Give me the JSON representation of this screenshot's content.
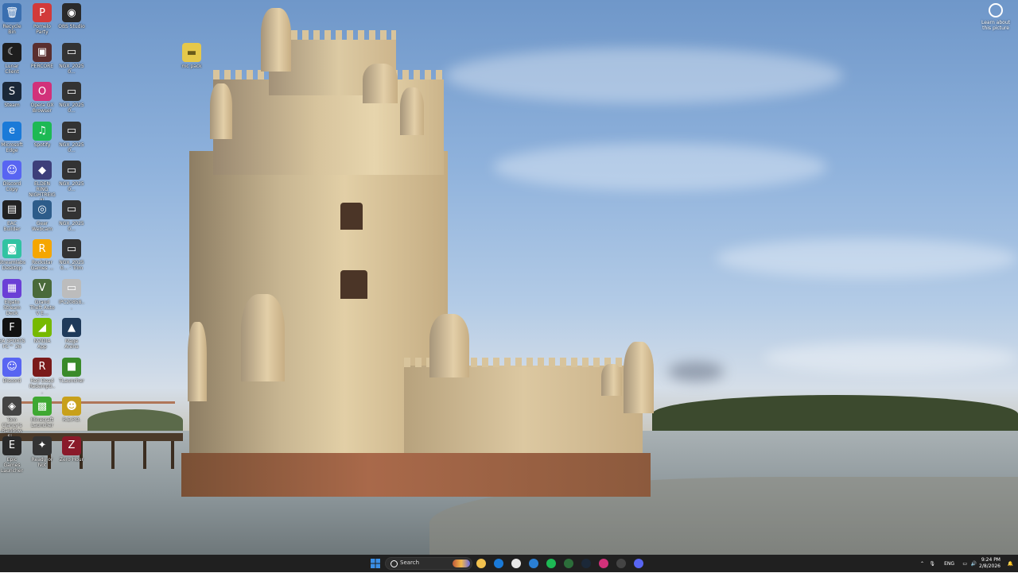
{
  "desktop_icons": [
    {
      "label": "Recycle Bin",
      "glyph": "🗑",
      "color": "#3a6fb0"
    },
    {
      "label": "Pomelo Party",
      "glyph": "P",
      "color": "#d23a3a"
    },
    {
      "label": "OBS Studio",
      "glyph": "◉",
      "color": "#2a2a2a"
    },
    {
      "label": "Lunar Client",
      "glyph": "☾",
      "color": "#1e1e1e"
    },
    {
      "label": "PERCORE",
      "glyph": "▣",
      "color": "#5a2e2e"
    },
    {
      "label": "NGX_20250...",
      "glyph": "▭",
      "color": "#333"
    },
    {
      "label": "Steam",
      "glyph": "S",
      "color": "#1b2838"
    },
    {
      "label": "Opera GX Browser",
      "glyph": "O",
      "color": "#d2317a"
    },
    {
      "label": "NGX_20250...",
      "glyph": "▭",
      "color": "#333"
    },
    {
      "label": "Microsoft Edge",
      "glyph": "e",
      "color": "#1a7ad8"
    },
    {
      "label": "Spotify",
      "glyph": "♫",
      "color": "#1db954"
    },
    {
      "label": "NGX_20250...",
      "glyph": "▭",
      "color": "#333"
    },
    {
      "label": "Discord Copy",
      "glyph": "☺",
      "color": "#5865f2"
    },
    {
      "label": "ELDEN RING NIGHTREIGN",
      "glyph": "◆",
      "color": "#3d3f7a"
    },
    {
      "label": "NGX_20250...",
      "glyph": "▭",
      "color": "#333"
    },
    {
      "label": "EAC Builder",
      "glyph": "▤",
      "color": "#222"
    },
    {
      "label": "Gear Webcam",
      "glyph": "◎",
      "color": "#2d5c8a"
    },
    {
      "label": "NGX_20250...",
      "glyph": "▭",
      "color": "#333"
    },
    {
      "label": "Streamlabs Desktop",
      "glyph": "◙",
      "color": "#31c3a2"
    },
    {
      "label": "Rockstar Games ...",
      "glyph": "R",
      "color": "#f5a600"
    },
    {
      "label": "NGX_20250... - Trim",
      "glyph": "▭",
      "color": "#333"
    },
    {
      "label": "Elgato Stream Deck",
      "glyph": "▦",
      "color": "#6b3fd6"
    },
    {
      "label": "Grand Theft Auto V E...",
      "glyph": "V",
      "color": "#4a6a3a"
    },
    {
      "label": "IPC20858...",
      "glyph": "▭",
      "color": "#bcbcbc"
    },
    {
      "label": "EA SPORTS FC™ 26",
      "glyph": "F",
      "color": "#111"
    },
    {
      "label": "NVIDIA App",
      "glyph": "◢",
      "color": "#76b900"
    },
    {
      "label": "Mage Arena",
      "glyph": "▲",
      "color": "#1f3a5a"
    },
    {
      "label": "Discord",
      "glyph": "☺",
      "color": "#5865f2"
    },
    {
      "label": "Red Dead Redempti...",
      "glyph": "R",
      "color": "#7a1a1a"
    },
    {
      "label": "TLauncher",
      "glyph": "■",
      "color": "#3a8a2a"
    },
    {
      "label": "Tom Clancy's Rainbow Si...",
      "glyph": "◈",
      "color": "#444"
    },
    {
      "label": "Minecraft Launcher",
      "glyph": "▩",
      "color": "#3ea832"
    },
    {
      "label": "R.E.P.O.",
      "glyph": "☻",
      "color": "#c8a01a"
    },
    {
      "label": "Epic Games Launcher",
      "glyph": "E",
      "color": "#2a2a2a"
    },
    {
      "label": "Ready or Not",
      "glyph": "✦",
      "color": "#333"
    },
    {
      "label": "Zero Hour",
      "glyph": "Z",
      "color": "#8a1a2a"
    }
  ],
  "extra_icon": {
    "label": "mc pack",
    "glyph": "▬",
    "color": "#e6c84a"
  },
  "learn_about": {
    "label": "Learn about this picture"
  },
  "taskbar": {
    "search_placeholder": "Search",
    "items": [
      {
        "name": "start-button",
        "color": "#3a8ee6"
      },
      {
        "name": "file-explorer-icon",
        "color": "#f2c14e"
      },
      {
        "name": "edge-icon",
        "color": "#1a7ad8"
      },
      {
        "name": "store-icon",
        "color": "#e8e8e8"
      },
      {
        "name": "mail-icon",
        "color": "#2a7fd4"
      },
      {
        "name": "spotify-icon",
        "color": "#1db954"
      },
      {
        "name": "excel-icon",
        "color": "#2c6e3a"
      },
      {
        "name": "steam-icon",
        "color": "#1b2838"
      },
      {
        "name": "opera-icon",
        "color": "#d2317a"
      },
      {
        "name": "obs-icon",
        "color": "#444"
      },
      {
        "name": "discord-icon",
        "color": "#5865f2"
      }
    ],
    "tray": {
      "language": "ENG",
      "time": "9:24 PM",
      "date": "2/8/2026"
    }
  }
}
